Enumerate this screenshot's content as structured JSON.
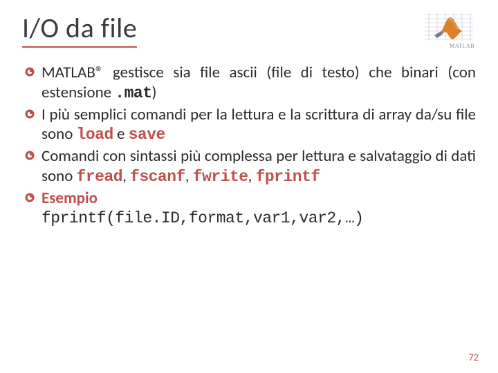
{
  "title": "I/O da file",
  "logo_label": "MATLAB",
  "bullets": {
    "b0": {
      "pre": "M",
      "smallcaps": "ATLAB",
      "sup": "® ",
      "t1": "gestisce sia file ascii (file di testo) che binari (con estensione ",
      "code1": ".mat",
      "t2": ")"
    },
    "b1": {
      "t1": "I più semplici comandi per la lettura e la scrittura di array da/su file sono ",
      "code1": "load",
      "t2": " e ",
      "code2": "save"
    },
    "b2": {
      "t1": "Comandi con sintassi più complessa per lettura e salvataggio di dati sono ",
      "code1": "fread",
      "c1": ", ",
      "code2": "fscanf",
      "c2": ", ",
      "code3": "fwrite",
      "c3": ", ",
      "code4": "fprintf"
    },
    "b3": {
      "label": "Esempio",
      "code": "fprintf(file.ID,format,var1,var2,…)"
    }
  },
  "page_number": "72"
}
